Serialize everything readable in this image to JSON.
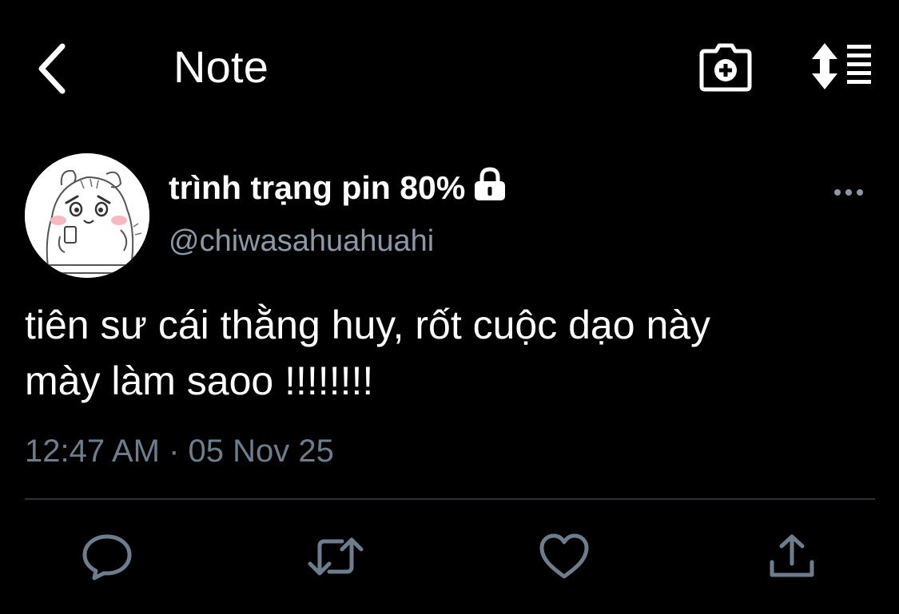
{
  "header": {
    "title": "Note",
    "back_icon": "chevron-left-icon",
    "camera_icon": "camera-plus-icon",
    "sort_icon": "sort-list-icon"
  },
  "author": {
    "display_name": "trình trạng pin 80%",
    "handle": "@chiwasahuahuahi",
    "protected_icon": "lock-icon"
  },
  "tweet": {
    "text_line1": "tiên sư cái thằng huy, rốt cuộc dạo này",
    "text_line2": "mày làm saoo !!!!!!!!",
    "timestamp": "12:47 AM · 05 Nov 25"
  },
  "actions": {
    "reply_icon": "reply-icon",
    "retweet_icon": "retweet-icon",
    "like_icon": "heart-icon",
    "share_icon": "share-icon"
  },
  "colors": {
    "background": "#000000",
    "text": "#ffffff",
    "secondary": "#8b98a5",
    "icon_gray": "#6e7d8b",
    "divider": "#2f3336"
  }
}
